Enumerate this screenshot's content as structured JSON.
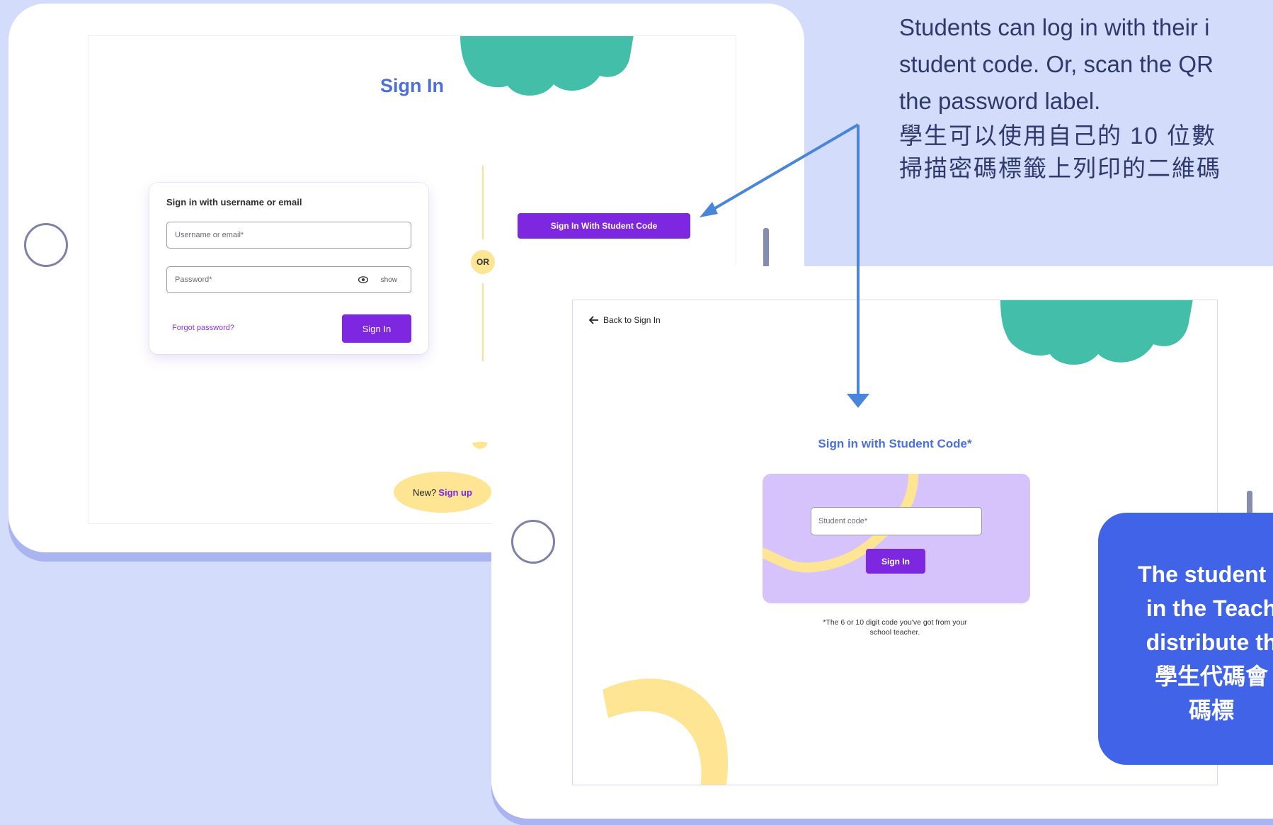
{
  "signin_screen": {
    "title": "Sign In",
    "card_title": "Sign in with username or email",
    "username_placeholder": "Username or email*",
    "password_placeholder": "Password*",
    "show_label": "show",
    "forgot_password": "Forgot password?",
    "signin_button": "Sign In",
    "or_label": "OR",
    "student_code_button": "Sign In With Student Code",
    "new_label": "New?",
    "signup_link": "Sign up"
  },
  "student_code_screen": {
    "back_label": "Back to Sign In",
    "title": "Sign in with Student Code*",
    "code_placeholder": "Student code*",
    "signin_button": "Sign In",
    "footnote_line1": "*The 6 or 10 digit code you've got from your",
    "footnote_line2": "school teacher."
  },
  "annotation_top": {
    "line1": "Students can log in with their i",
    "line2": "student code. Or, scan the QR",
    "line3": "the password label.",
    "line4": "學生可以使用自己的 10 位數",
    "line5": "掃描密碼標籤上列印的二維碼"
  },
  "annotation_box": {
    "line1": "The student c",
    "line2": "in the Teach",
    "line3": "distribute th",
    "line4": "學生代碼會",
    "line5": "碼標"
  },
  "colors": {
    "background": "#d3dcfb",
    "purple_button": "#7d27e0",
    "title_blue": "#4b6fdb",
    "green_blob": "#43bfa9",
    "yellow": "#fde594",
    "arrow_blue": "#4a86d8",
    "annotation_box": "#4163e8"
  },
  "icons": {
    "eye": "eye-icon",
    "back_arrow": "arrow-left-icon",
    "home_button": "circle-home-button"
  }
}
